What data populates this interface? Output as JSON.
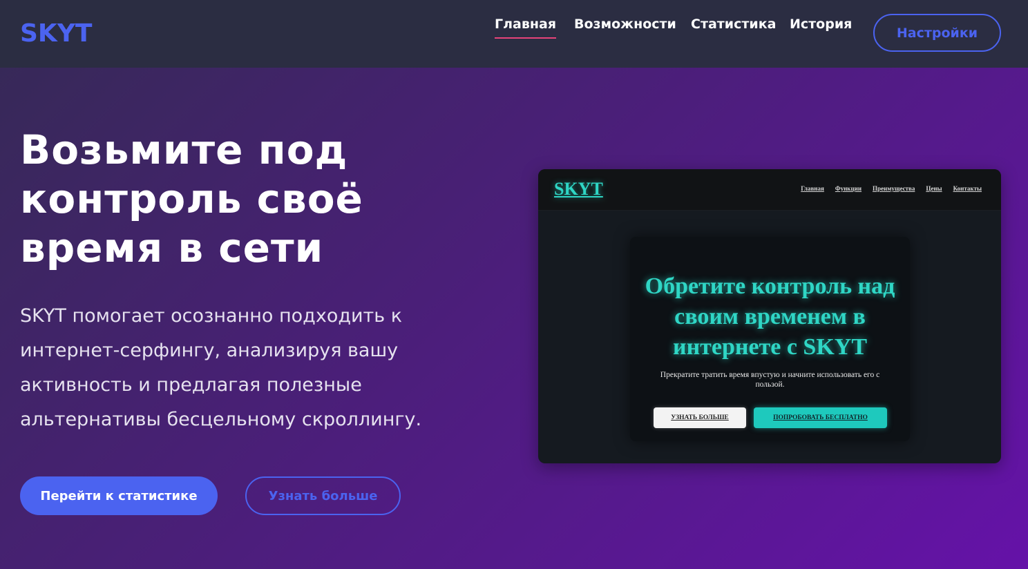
{
  "header": {
    "logo": "SKYT",
    "nav": [
      {
        "label": "Главная",
        "active": true
      },
      {
        "label": "Возможности",
        "active": false
      },
      {
        "label": "Статистика",
        "active": false
      },
      {
        "label": "История",
        "active": false
      }
    ],
    "settings_label": "Настройки"
  },
  "hero": {
    "title": "Возьмите под контроль своё время в сети",
    "description": "SKYT помогает осознанно подходить к интернет-серфингу, анализируя вашу активность и предлагая полезные альтернативы бесцельному скроллингу.",
    "primary_button": "Перейти к статистике",
    "secondary_button": "Узнать больше"
  },
  "preview": {
    "logo": "SKYT",
    "nav": [
      "Главная",
      "Функции",
      "Преимущества",
      "Цены",
      "Контакты"
    ],
    "title": "Обретите контроль над своим временем в интернете с SKYT",
    "subtitle": "Прекратите тратить время впустую и начните использовать его с пользой.",
    "button_learn": "УЗНАТЬ БОЛЬШЕ",
    "button_try": "ПОПРОБОВАТЬ БЕСПЛАТНО"
  },
  "colors": {
    "accent": "#4b63f0",
    "active_underline": "#e8447a",
    "preview_accent": "#2fd6c5",
    "header_bg": "#2b2d42"
  }
}
